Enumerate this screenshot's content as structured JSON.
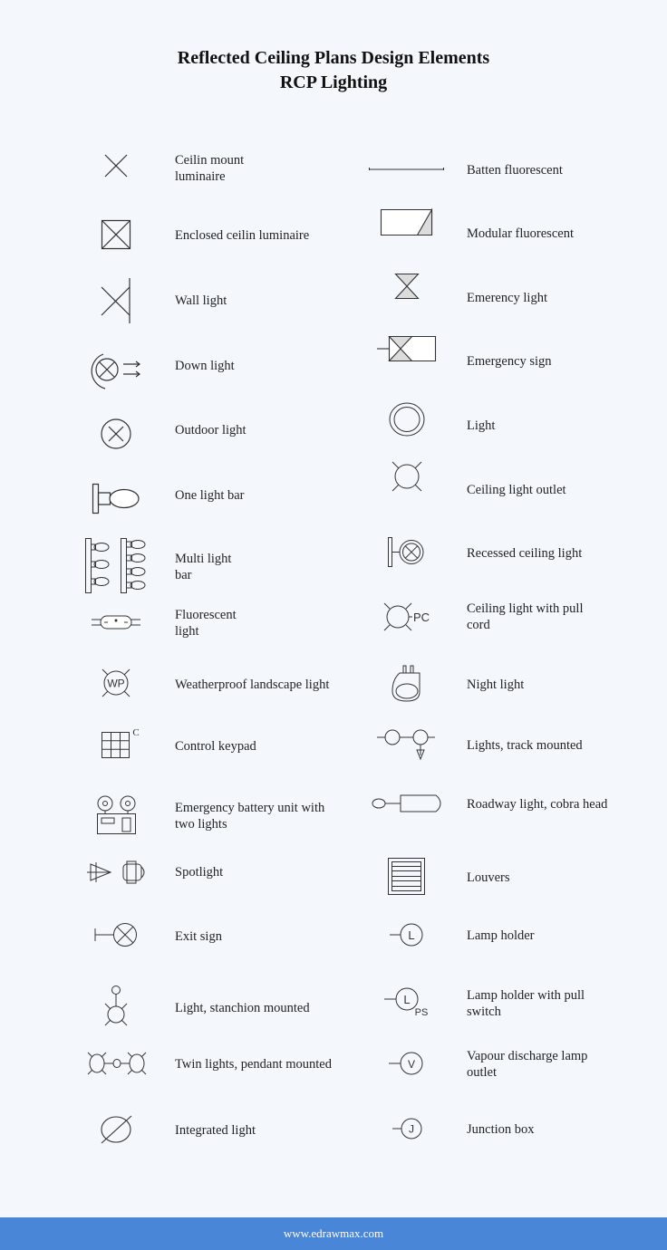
{
  "header": {
    "title_line1": "Reflected Ceiling Plans Design Elements",
    "title_line2": "RCP Lighting"
  },
  "left_column": [
    {
      "icon": "ceiling-mount-luminaire-icon",
      "line1": "Ceilin mount",
      "line2": "luminaire"
    },
    {
      "icon": "enclosed-ceiling-luminaire-icon",
      "line1": "Enclosed ceilin  luminaire",
      "line2": ""
    },
    {
      "icon": "wall-light-icon",
      "line1": "Wall light",
      "line2": ""
    },
    {
      "icon": "down-light-icon",
      "line1": "Down light",
      "line2": ""
    },
    {
      "icon": "outdoor-light-icon",
      "line1": "Outdoor light",
      "line2": ""
    },
    {
      "icon": "one-light-bar-icon",
      "line1": "One light bar",
      "line2": ""
    },
    {
      "icon": "multi-light-bar-icon",
      "line1": "Multi light",
      "line2": "bar"
    },
    {
      "icon": "fluorescent-light-icon",
      "line1": "Fluorescent",
      "line2": "light"
    },
    {
      "icon": "weatherproof-landscape-light-icon",
      "line1": "Weatherproof landscape light",
      "line2": "",
      "icon_text": "WP"
    },
    {
      "icon": "control-keypad-icon",
      "line1": "Control keypad",
      "line2": "",
      "icon_text": "C"
    },
    {
      "icon": "emergency-battery-unit-icon",
      "line1": "Emergency battery unit with",
      "line2": "two lights"
    },
    {
      "icon": "spotlight-icon",
      "line1": "Spotlight",
      "line2": ""
    },
    {
      "icon": "exit-sign-icon",
      "line1": "Exit sign",
      "line2": ""
    },
    {
      "icon": "stanchion-mounted-light-icon",
      "line1": "Light, stanchion mounted",
      "line2": ""
    },
    {
      "icon": "twin-pendant-lights-icon",
      "line1": "Twin lights, pendant mounted",
      "line2": ""
    },
    {
      "icon": "integrated-light-icon",
      "line1": "Integrated light",
      "line2": ""
    }
  ],
  "right_column": [
    {
      "icon": "batten-fluorescent-icon",
      "line1": "Batten fluorescent",
      "line2": ""
    },
    {
      "icon": "modular-fluorescent-icon",
      "line1": "Modular fluorescent",
      "line2": ""
    },
    {
      "icon": "emergency-light-icon",
      "line1": "Emerency light",
      "line2": ""
    },
    {
      "icon": "emergency-sign-icon",
      "line1": "Emergency sign",
      "line2": ""
    },
    {
      "icon": "light-icon",
      "line1": "Light",
      "line2": ""
    },
    {
      "icon": "ceiling-light-outlet-icon",
      "line1": "Ceiling light outlet",
      "line2": ""
    },
    {
      "icon": "recessed-ceiling-light-icon",
      "line1": "Recessed ceiling light",
      "line2": ""
    },
    {
      "icon": "ceiling-light-pull-cord-icon",
      "line1": "Ceiling light with pull",
      "line2": "cord",
      "icon_text": "PC"
    },
    {
      "icon": "night-light-icon",
      "line1": "Night light",
      "line2": ""
    },
    {
      "icon": "track-mounted-lights-icon",
      "line1": "Lights, track mounted",
      "line2": ""
    },
    {
      "icon": "roadway-cobra-head-light-icon",
      "line1": "Roadway light, cobra head",
      "line2": ""
    },
    {
      "icon": "louvers-icon",
      "line1": "Louvers",
      "line2": ""
    },
    {
      "icon": "lamp-holder-icon",
      "line1": "Lamp holder",
      "line2": "",
      "icon_text": "L"
    },
    {
      "icon": "lamp-holder-pull-switch-icon",
      "line1": "Lamp holder with pull",
      "line2": "switch",
      "icon_text": "L",
      "icon_subtext": "PS"
    },
    {
      "icon": "vapour-discharge-lamp-outlet-icon",
      "line1": "Vapour discharge lamp",
      "line2": "outlet",
      "icon_text": "V"
    },
    {
      "icon": "junction-box-icon",
      "line1": "Junction box",
      "line2": "",
      "icon_text": "J"
    }
  ],
  "footer": {
    "url": "www.edrawmax.com"
  },
  "colors": {
    "background": "#f4f8fd",
    "footer": "#4a86d8",
    "stroke": "#333333",
    "shade": "#dcdcdc"
  }
}
